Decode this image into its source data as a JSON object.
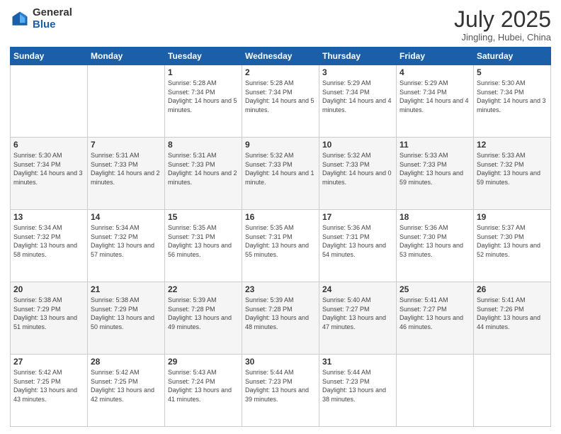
{
  "header": {
    "logo_general": "General",
    "logo_blue": "Blue",
    "title": "July 2025",
    "subtitle": "Jingling, Hubei, China"
  },
  "weekdays": [
    "Sunday",
    "Monday",
    "Tuesday",
    "Wednesday",
    "Thursday",
    "Friday",
    "Saturday"
  ],
  "weeks": [
    [
      {
        "day": "",
        "info": ""
      },
      {
        "day": "",
        "info": ""
      },
      {
        "day": "1",
        "info": "Sunrise: 5:28 AM\nSunset: 7:34 PM\nDaylight: 14 hours and 5 minutes."
      },
      {
        "day": "2",
        "info": "Sunrise: 5:28 AM\nSunset: 7:34 PM\nDaylight: 14 hours and 5 minutes."
      },
      {
        "day": "3",
        "info": "Sunrise: 5:29 AM\nSunset: 7:34 PM\nDaylight: 14 hours and 4 minutes."
      },
      {
        "day": "4",
        "info": "Sunrise: 5:29 AM\nSunset: 7:34 PM\nDaylight: 14 hours and 4 minutes."
      },
      {
        "day": "5",
        "info": "Sunrise: 5:30 AM\nSunset: 7:34 PM\nDaylight: 14 hours and 3 minutes."
      }
    ],
    [
      {
        "day": "6",
        "info": "Sunrise: 5:30 AM\nSunset: 7:34 PM\nDaylight: 14 hours and 3 minutes."
      },
      {
        "day": "7",
        "info": "Sunrise: 5:31 AM\nSunset: 7:33 PM\nDaylight: 14 hours and 2 minutes."
      },
      {
        "day": "8",
        "info": "Sunrise: 5:31 AM\nSunset: 7:33 PM\nDaylight: 14 hours and 2 minutes."
      },
      {
        "day": "9",
        "info": "Sunrise: 5:32 AM\nSunset: 7:33 PM\nDaylight: 14 hours and 1 minute."
      },
      {
        "day": "10",
        "info": "Sunrise: 5:32 AM\nSunset: 7:33 PM\nDaylight: 14 hours and 0 minutes."
      },
      {
        "day": "11",
        "info": "Sunrise: 5:33 AM\nSunset: 7:33 PM\nDaylight: 13 hours and 59 minutes."
      },
      {
        "day": "12",
        "info": "Sunrise: 5:33 AM\nSunset: 7:32 PM\nDaylight: 13 hours and 59 minutes."
      }
    ],
    [
      {
        "day": "13",
        "info": "Sunrise: 5:34 AM\nSunset: 7:32 PM\nDaylight: 13 hours and 58 minutes."
      },
      {
        "day": "14",
        "info": "Sunrise: 5:34 AM\nSunset: 7:32 PM\nDaylight: 13 hours and 57 minutes."
      },
      {
        "day": "15",
        "info": "Sunrise: 5:35 AM\nSunset: 7:31 PM\nDaylight: 13 hours and 56 minutes."
      },
      {
        "day": "16",
        "info": "Sunrise: 5:35 AM\nSunset: 7:31 PM\nDaylight: 13 hours and 55 minutes."
      },
      {
        "day": "17",
        "info": "Sunrise: 5:36 AM\nSunset: 7:31 PM\nDaylight: 13 hours and 54 minutes."
      },
      {
        "day": "18",
        "info": "Sunrise: 5:36 AM\nSunset: 7:30 PM\nDaylight: 13 hours and 53 minutes."
      },
      {
        "day": "19",
        "info": "Sunrise: 5:37 AM\nSunset: 7:30 PM\nDaylight: 13 hours and 52 minutes."
      }
    ],
    [
      {
        "day": "20",
        "info": "Sunrise: 5:38 AM\nSunset: 7:29 PM\nDaylight: 13 hours and 51 minutes."
      },
      {
        "day": "21",
        "info": "Sunrise: 5:38 AM\nSunset: 7:29 PM\nDaylight: 13 hours and 50 minutes."
      },
      {
        "day": "22",
        "info": "Sunrise: 5:39 AM\nSunset: 7:28 PM\nDaylight: 13 hours and 49 minutes."
      },
      {
        "day": "23",
        "info": "Sunrise: 5:39 AM\nSunset: 7:28 PM\nDaylight: 13 hours and 48 minutes."
      },
      {
        "day": "24",
        "info": "Sunrise: 5:40 AM\nSunset: 7:27 PM\nDaylight: 13 hours and 47 minutes."
      },
      {
        "day": "25",
        "info": "Sunrise: 5:41 AM\nSunset: 7:27 PM\nDaylight: 13 hours and 46 minutes."
      },
      {
        "day": "26",
        "info": "Sunrise: 5:41 AM\nSunset: 7:26 PM\nDaylight: 13 hours and 44 minutes."
      }
    ],
    [
      {
        "day": "27",
        "info": "Sunrise: 5:42 AM\nSunset: 7:25 PM\nDaylight: 13 hours and 43 minutes."
      },
      {
        "day": "28",
        "info": "Sunrise: 5:42 AM\nSunset: 7:25 PM\nDaylight: 13 hours and 42 minutes."
      },
      {
        "day": "29",
        "info": "Sunrise: 5:43 AM\nSunset: 7:24 PM\nDaylight: 13 hours and 41 minutes."
      },
      {
        "day": "30",
        "info": "Sunrise: 5:44 AM\nSunset: 7:23 PM\nDaylight: 13 hours and 39 minutes."
      },
      {
        "day": "31",
        "info": "Sunrise: 5:44 AM\nSunset: 7:23 PM\nDaylight: 13 hours and 38 minutes."
      },
      {
        "day": "",
        "info": ""
      },
      {
        "day": "",
        "info": ""
      }
    ]
  ]
}
